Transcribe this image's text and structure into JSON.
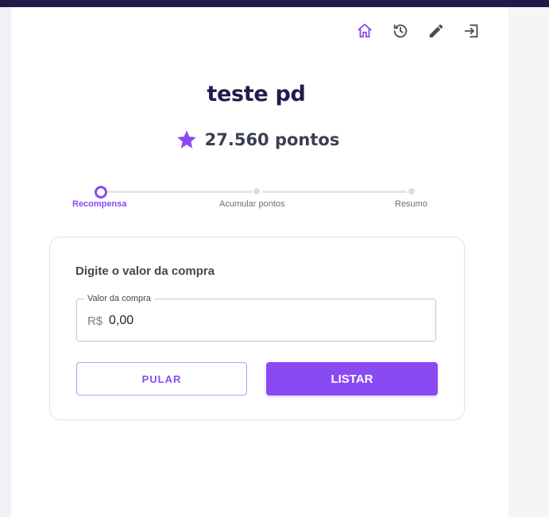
{
  "header": {
    "icons": [
      "home-icon",
      "history-icon",
      "edit-icon",
      "logout-icon"
    ],
    "accent_color": "#8a4af3",
    "icon_color": "#4a4d5a"
  },
  "user": {
    "name": "teste pd",
    "points": "27.560 pontos"
  },
  "stepper": {
    "steps": [
      {
        "label": "Recompensa",
        "active": true
      },
      {
        "label": "Acumular pontos",
        "active": false
      },
      {
        "label": "Resumo",
        "active": false
      }
    ]
  },
  "form": {
    "title": "Digite o valor da compra",
    "field_label": "Valor da compra",
    "currency": "R$",
    "value": "0,00",
    "skip_label": "PULAR",
    "list_label": "LISTAR"
  }
}
